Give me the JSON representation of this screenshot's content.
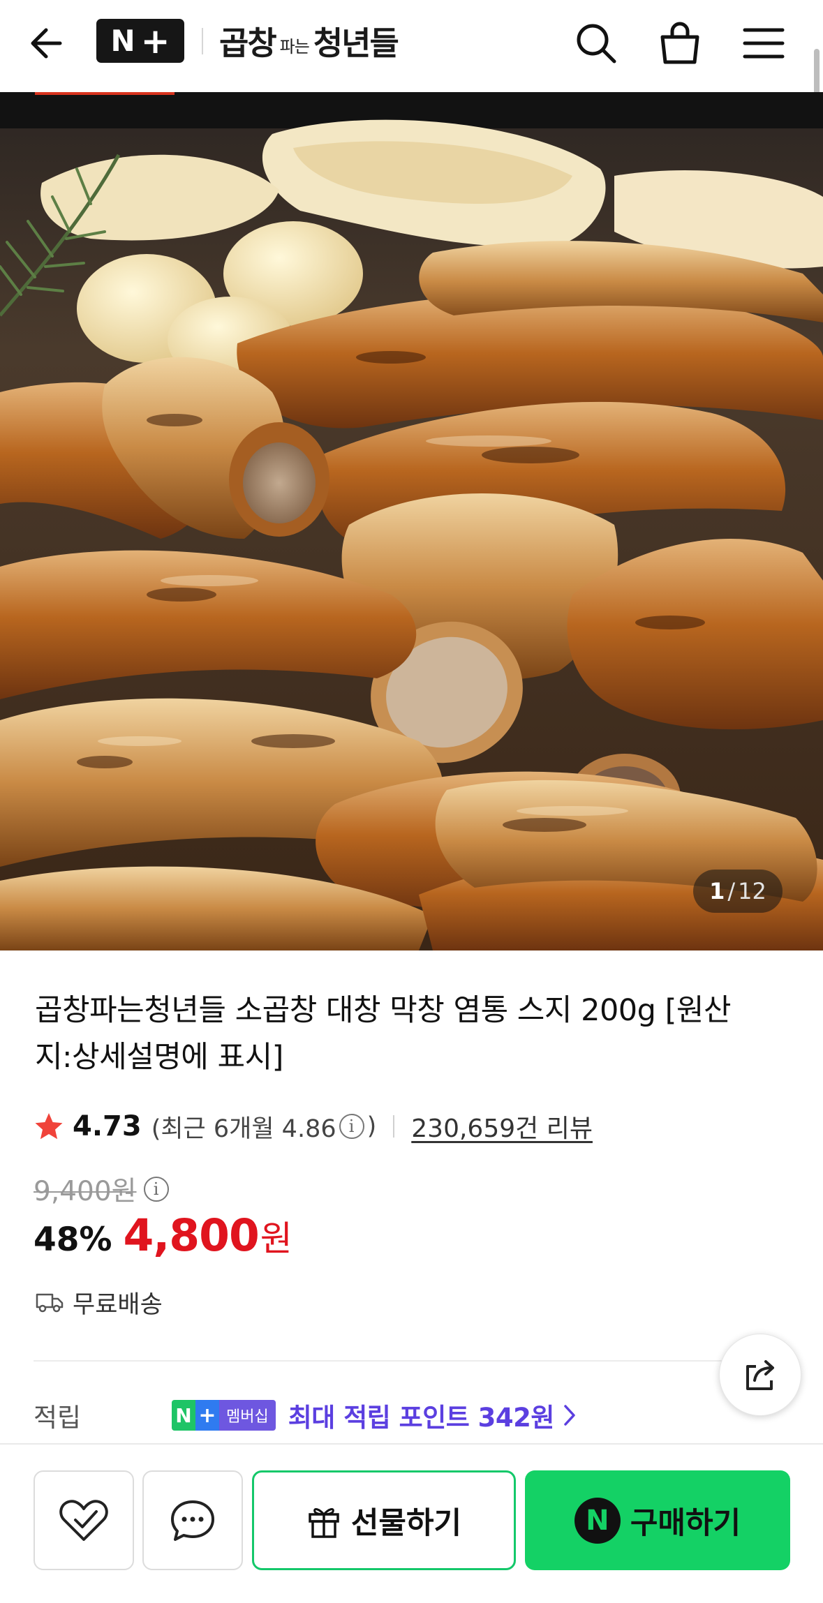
{
  "header": {
    "logo_n": "N",
    "logo_plus": "+",
    "brand_big_1": "곱창",
    "brand_small": "파는",
    "brand_big_2": "청년들"
  },
  "gallery": {
    "current": "1",
    "separator": "/",
    "total": "12"
  },
  "product": {
    "title": "곱창파는청년들 소곱창 대창 막창 염통 스지 200g [원산지:상세설명에 표시]",
    "rating": "4.73",
    "recent_label": "(최근 6개월 4.86",
    "recent_close": ")",
    "reviews": "230,659건 리뷰",
    "original_price": "9,400원",
    "discount": "48%",
    "price": "4,800",
    "currency": "원",
    "shipping": "무료배송"
  },
  "points": {
    "label": "적립",
    "badge_n": "N",
    "badge_plus": "+",
    "badge_member": "멤버십",
    "text": "최대 적립 포인트 342원"
  },
  "bottom_bar": {
    "gift_label": "선물하기",
    "buy_icon": "N",
    "buy_label": "구매하기"
  },
  "colors": {
    "price_red": "#e0141e",
    "naver_green": "#14d165",
    "points_purple": "#5b3fe0",
    "star_red": "#f0433a"
  }
}
